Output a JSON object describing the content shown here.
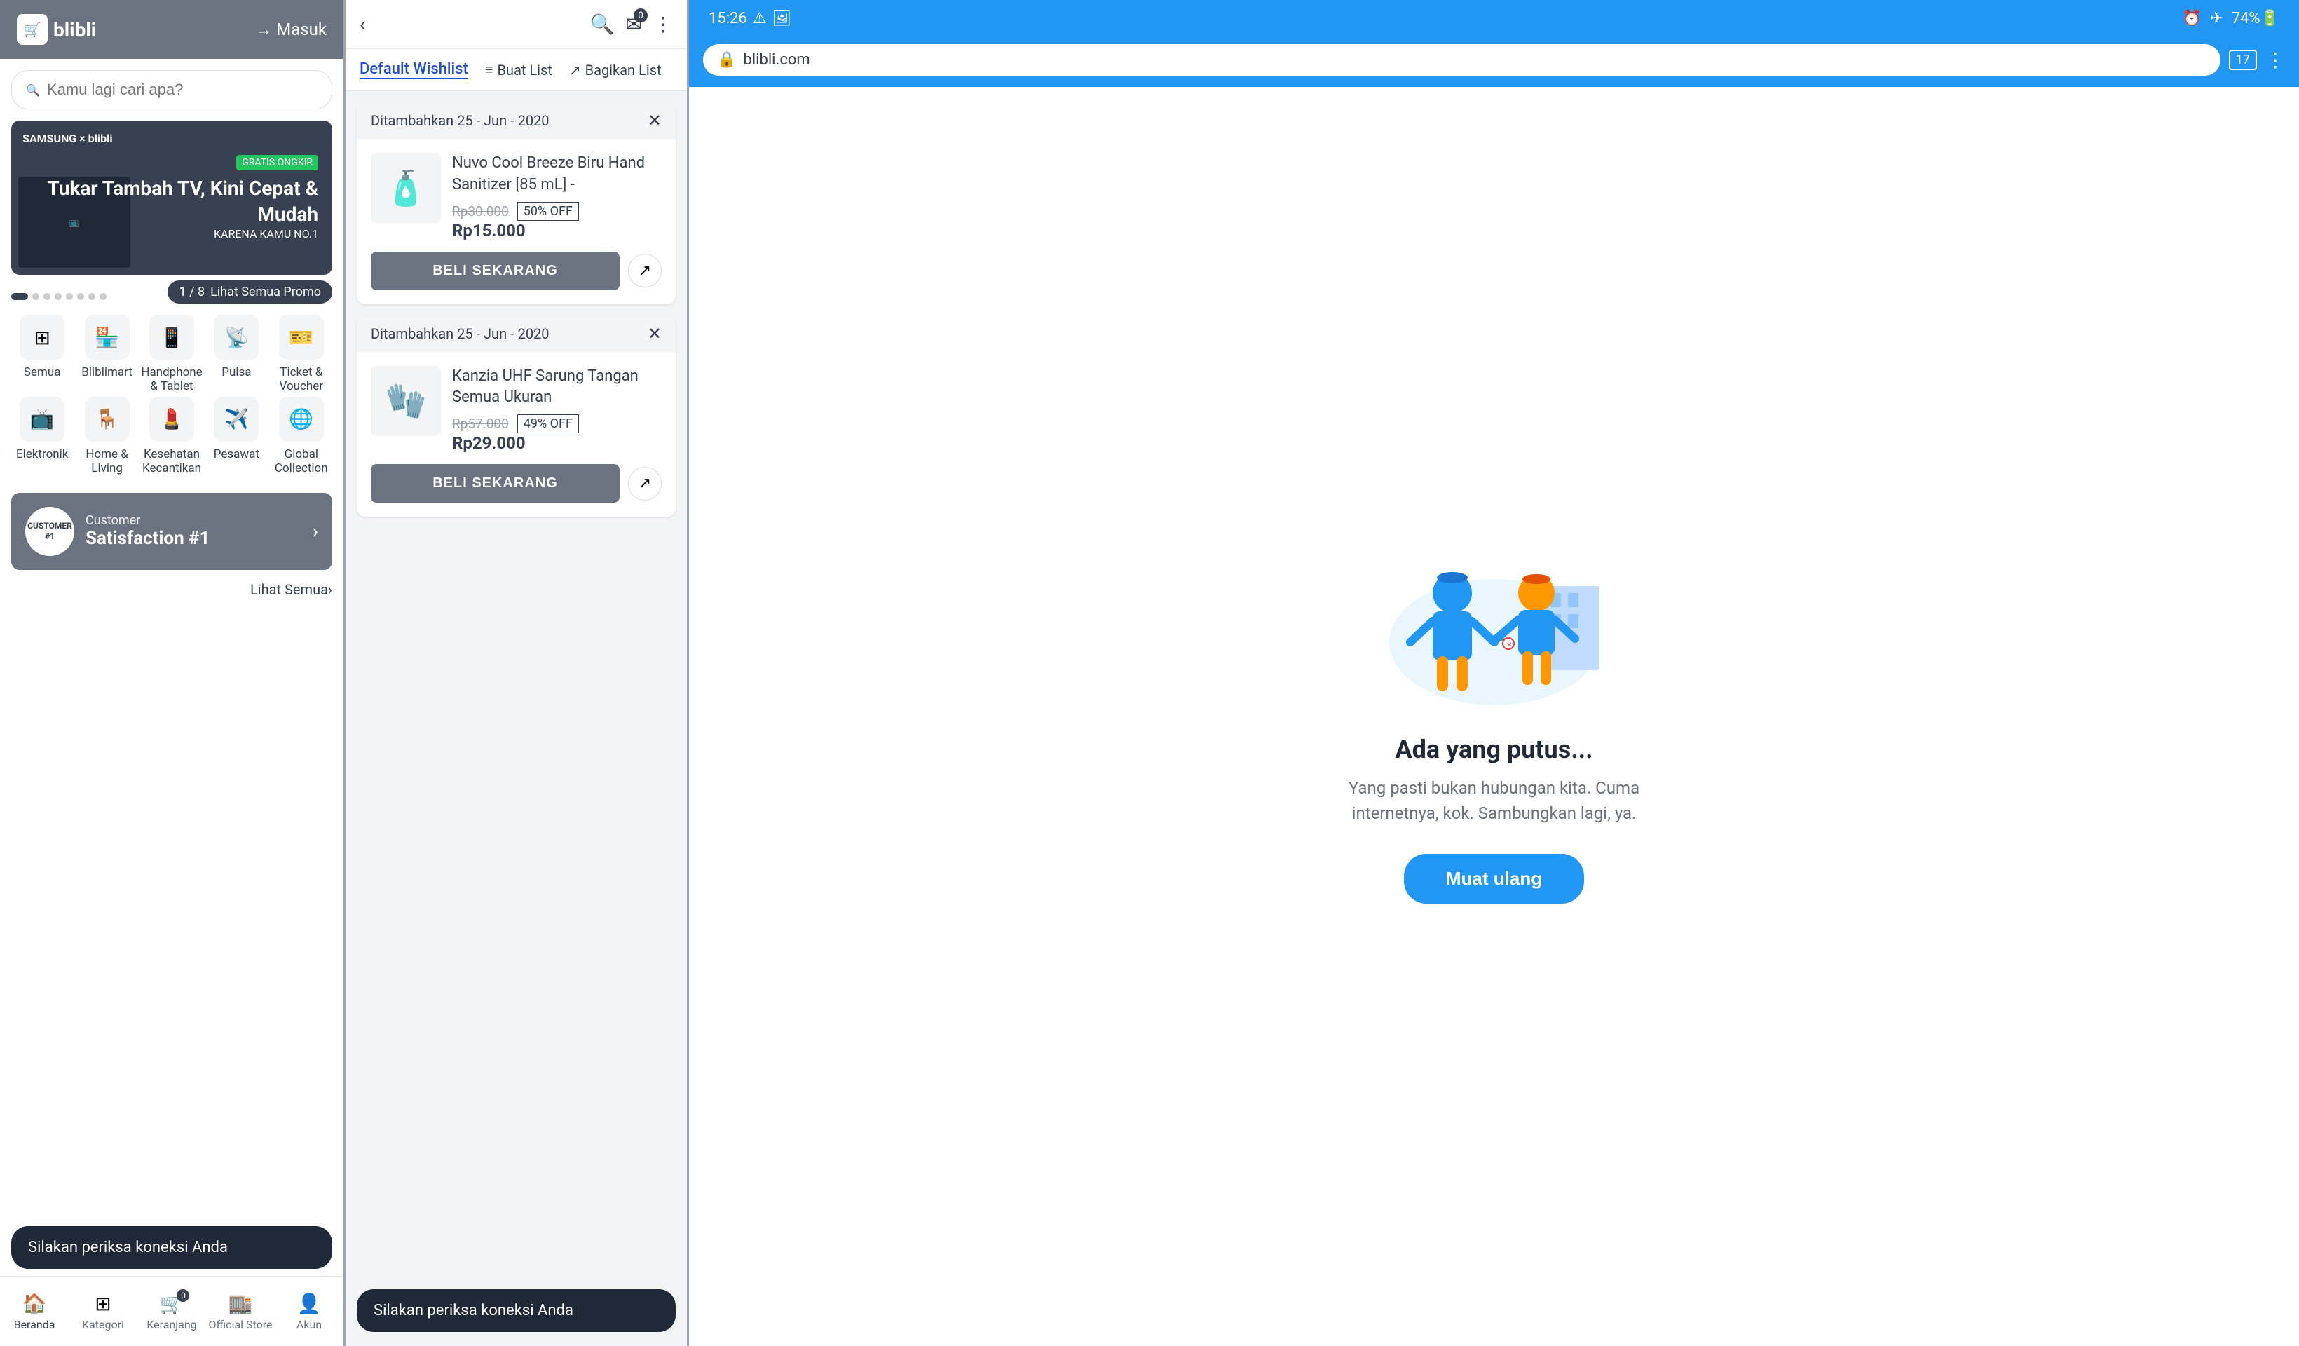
{
  "panel1": {
    "logo": "blibli",
    "logo_icon": "🛒",
    "masuk_label": "Masuk",
    "search_placeholder": "Kamu lagi cari apa?",
    "banner": {
      "gratis_label": "GRATIS ONGKIR",
      "brand": "SAMSUNG × blibli",
      "title": "Tukar Tambah TV, Kini Cepat & Mudah",
      "subtitle": "KARENA KAMU NO.1"
    },
    "promo": {
      "page": "1 / 8",
      "label": "Lihat Semua Promo"
    },
    "categories": [
      {
        "icon": "⊞",
        "label": "Semua"
      },
      {
        "icon": "🏪",
        "label": "Bliblimart"
      },
      {
        "icon": "📱",
        "label": "Handphone & Tablet"
      },
      {
        "icon": "📡",
        "label": "Pulsa"
      },
      {
        "icon": "🎫",
        "label": "Ticket & Voucher"
      },
      {
        "icon": "📺",
        "label": "Elektronik"
      },
      {
        "icon": "🪑",
        "label": "Home & Living"
      },
      {
        "icon": "💄",
        "label": "Kesehatan Kecantikan"
      },
      {
        "icon": "✈️",
        "label": "Pesawat"
      },
      {
        "icon": "🌐",
        "label": "Global Collection"
      }
    ],
    "satisfaction": {
      "badge": "CUSTOMER #1",
      "top": "Customer",
      "bottom": "Satisfaction #1"
    },
    "toast": "Silakan periksa koneksi Anda",
    "lihat_semua": "Lihat Semua",
    "bottom_nav": [
      {
        "icon": "🏠",
        "label": "Beranda",
        "active": true
      },
      {
        "icon": "⊞",
        "label": "Kategori",
        "active": false
      },
      {
        "icon": "🛒",
        "label": "Keranjang",
        "active": false,
        "badge": "0"
      },
      {
        "icon": "🏬",
        "label": "Official Store",
        "active": false
      },
      {
        "icon": "👤",
        "label": "Akun",
        "active": false
      }
    ]
  },
  "panel2": {
    "wishlist_title": "Default Wishlist",
    "buat_list": "Buat List",
    "bagikan_list": "Bagikan List",
    "items": [
      {
        "date": "Ditambahkan 25 - Jun - 2020",
        "product_name": "Nuvo Cool Breeze Biru Hand Sanitizer [85 mL] -",
        "original_price": "Rp30.000",
        "discount": "50% OFF",
        "sale_price": "Rp15.000",
        "beli_label": "BELI SEKARANG",
        "icon": "🧴"
      },
      {
        "date": "Ditambahkan 25 - Jun - 2020",
        "product_name": "Kanzia UHF Sarung Tangan Semua Ukuran",
        "original_price": "Rp57.000",
        "discount": "49% OFF",
        "sale_price": "Rp29.000",
        "beli_label": "BELI SEKARANG",
        "icon": "🧤"
      }
    ],
    "toast": "Silakan periksa koneksi Anda"
  },
  "panel3": {
    "status_bar": {
      "time": "15:26",
      "battery": "74%",
      "tab_count": "17"
    },
    "url": "blibli.com",
    "title": "Ada yang putus...",
    "description": "Yang pasti bukan hubungan kita. Cuma internetnya, kok. Sambungkan lagi, ya.",
    "reload_label": "Muat ulang"
  }
}
